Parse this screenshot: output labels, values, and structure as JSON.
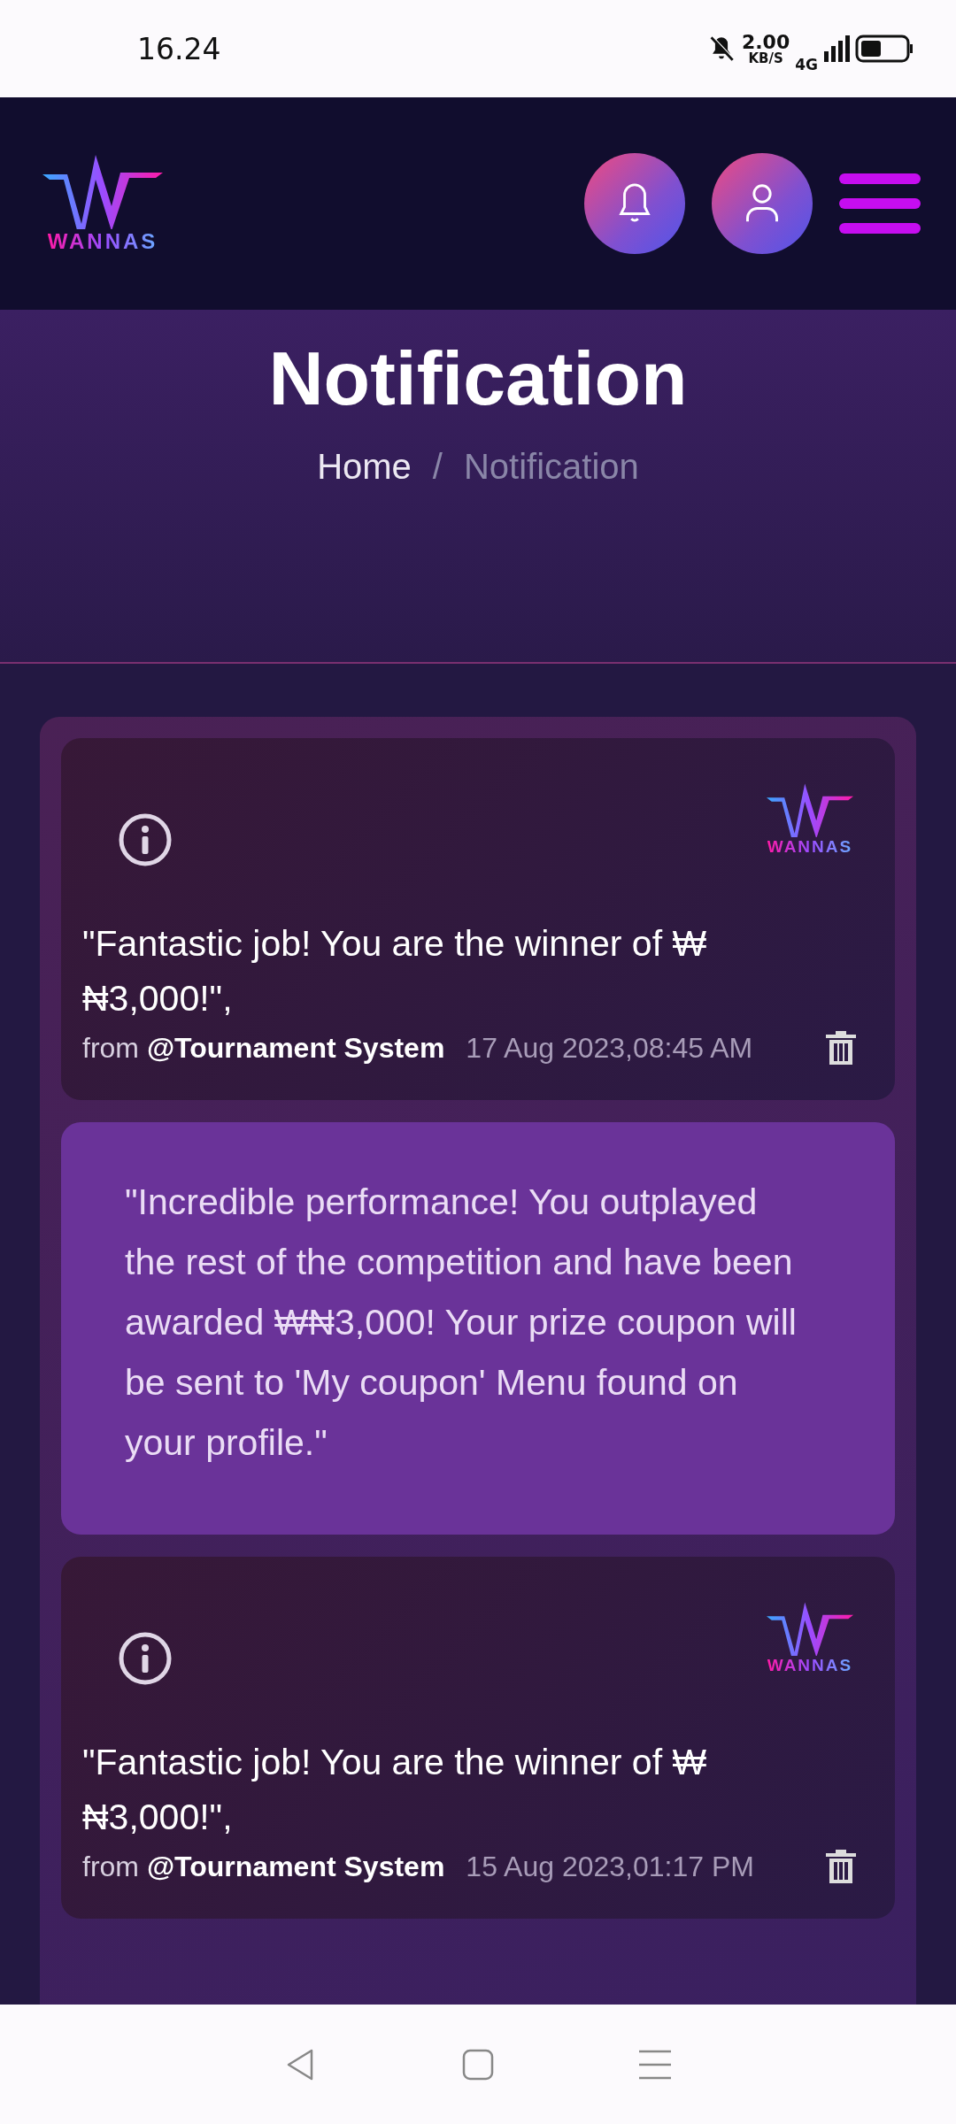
{
  "status_bar": {
    "time": "16.24",
    "speed": "2.00",
    "speed_unit": "KB/S",
    "network": "4G"
  },
  "header": {
    "logo": "WANNAS"
  },
  "hero": {
    "title": "Notification",
    "breadcrumb": [
      "Home",
      "Notification"
    ],
    "separator": "/"
  },
  "notifications": [
    {
      "logo": "WANNAS",
      "title": "\"Fantastic job! You are the winner of ₩ ₦3,000!\",",
      "from": "from",
      "sender": "@Tournament System",
      "date": "17 Aug 2023,08:45 AM",
      "message": "\"Incredible performance! You outplayed the rest of the competition and have been awarded ₩₦3,000! Your prize coupon will be sent to 'My coupon' Menu found on your profile.\""
    },
    {
      "logo": "WANNAS",
      "title": "\"Fantastic job! You are the winner of ₩ ₦3,000!\",",
      "from": "from",
      "sender": "@Tournament System",
      "date": "15 Aug 2023,01:17 PM"
    }
  ]
}
